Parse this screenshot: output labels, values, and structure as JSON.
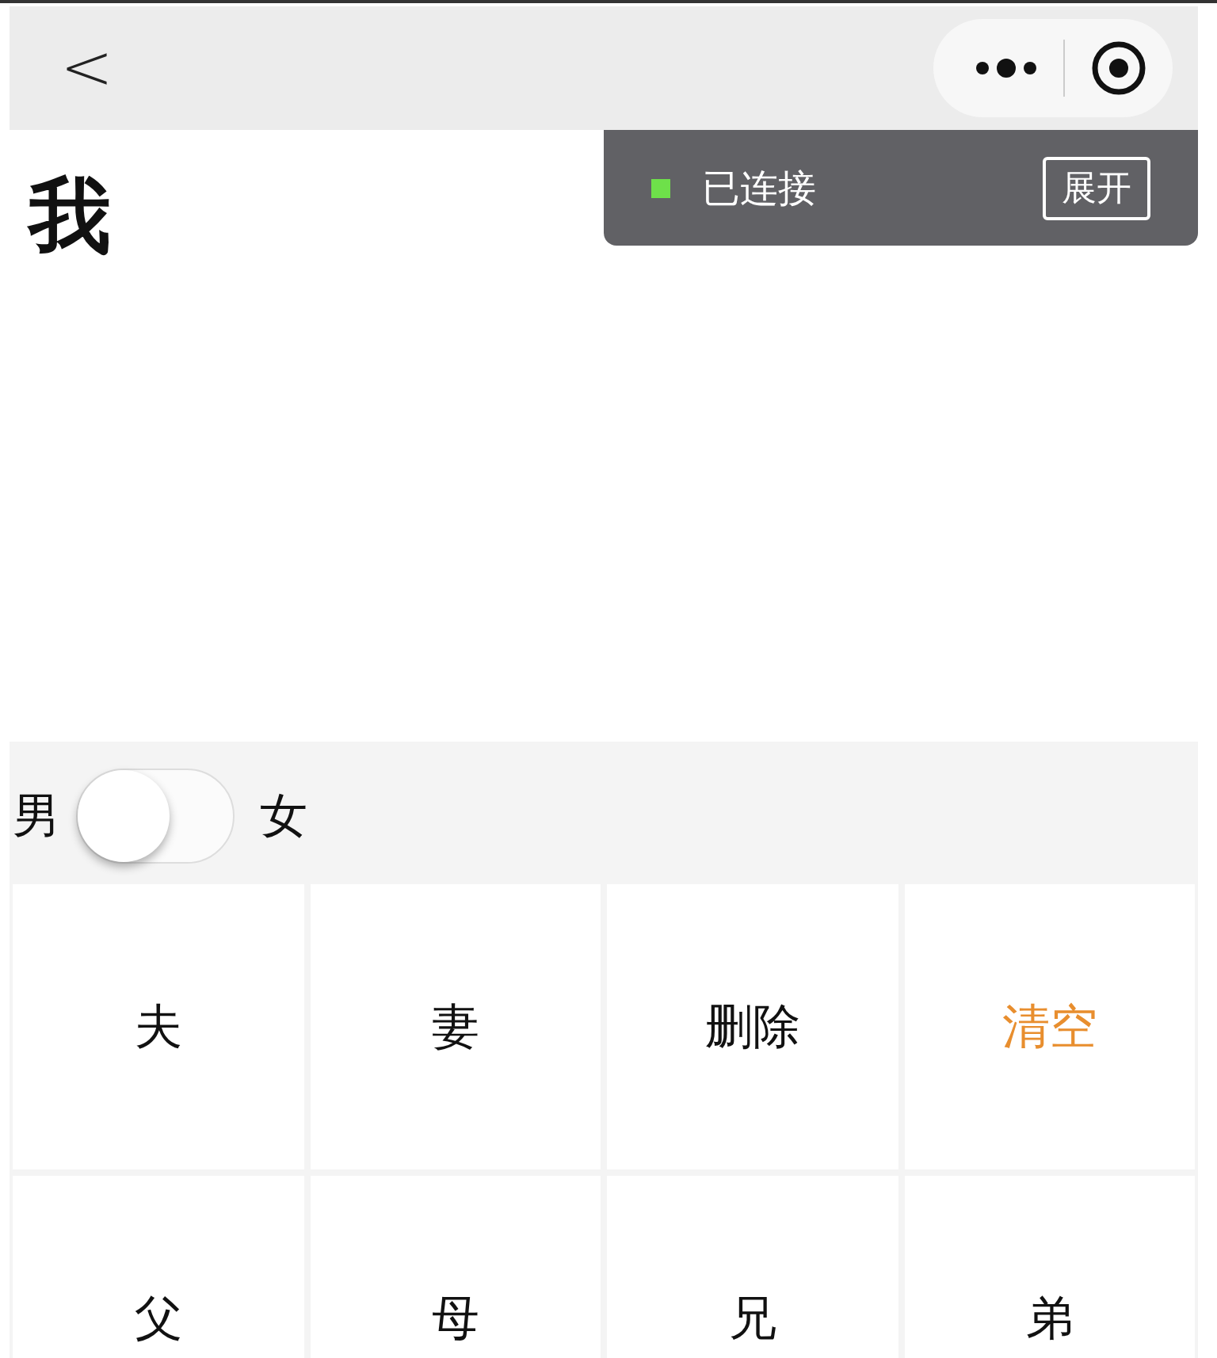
{
  "nav": {
    "back": "<"
  },
  "title": "我",
  "status_toast": {
    "color": "#6ee04a",
    "text": "已连接",
    "button": "展开"
  },
  "gender_switch": {
    "left_label": "男",
    "right_label": "女",
    "on": false
  },
  "keys": [
    {
      "label": "夫",
      "kind": "normal"
    },
    {
      "label": "妻",
      "kind": "normal"
    },
    {
      "label": "删除",
      "kind": "normal"
    },
    {
      "label": "清空",
      "kind": "clear"
    },
    {
      "label": "父",
      "kind": "normal"
    },
    {
      "label": "母",
      "kind": "normal"
    },
    {
      "label": "兄",
      "kind": "normal"
    },
    {
      "label": "弟",
      "kind": "normal"
    }
  ]
}
